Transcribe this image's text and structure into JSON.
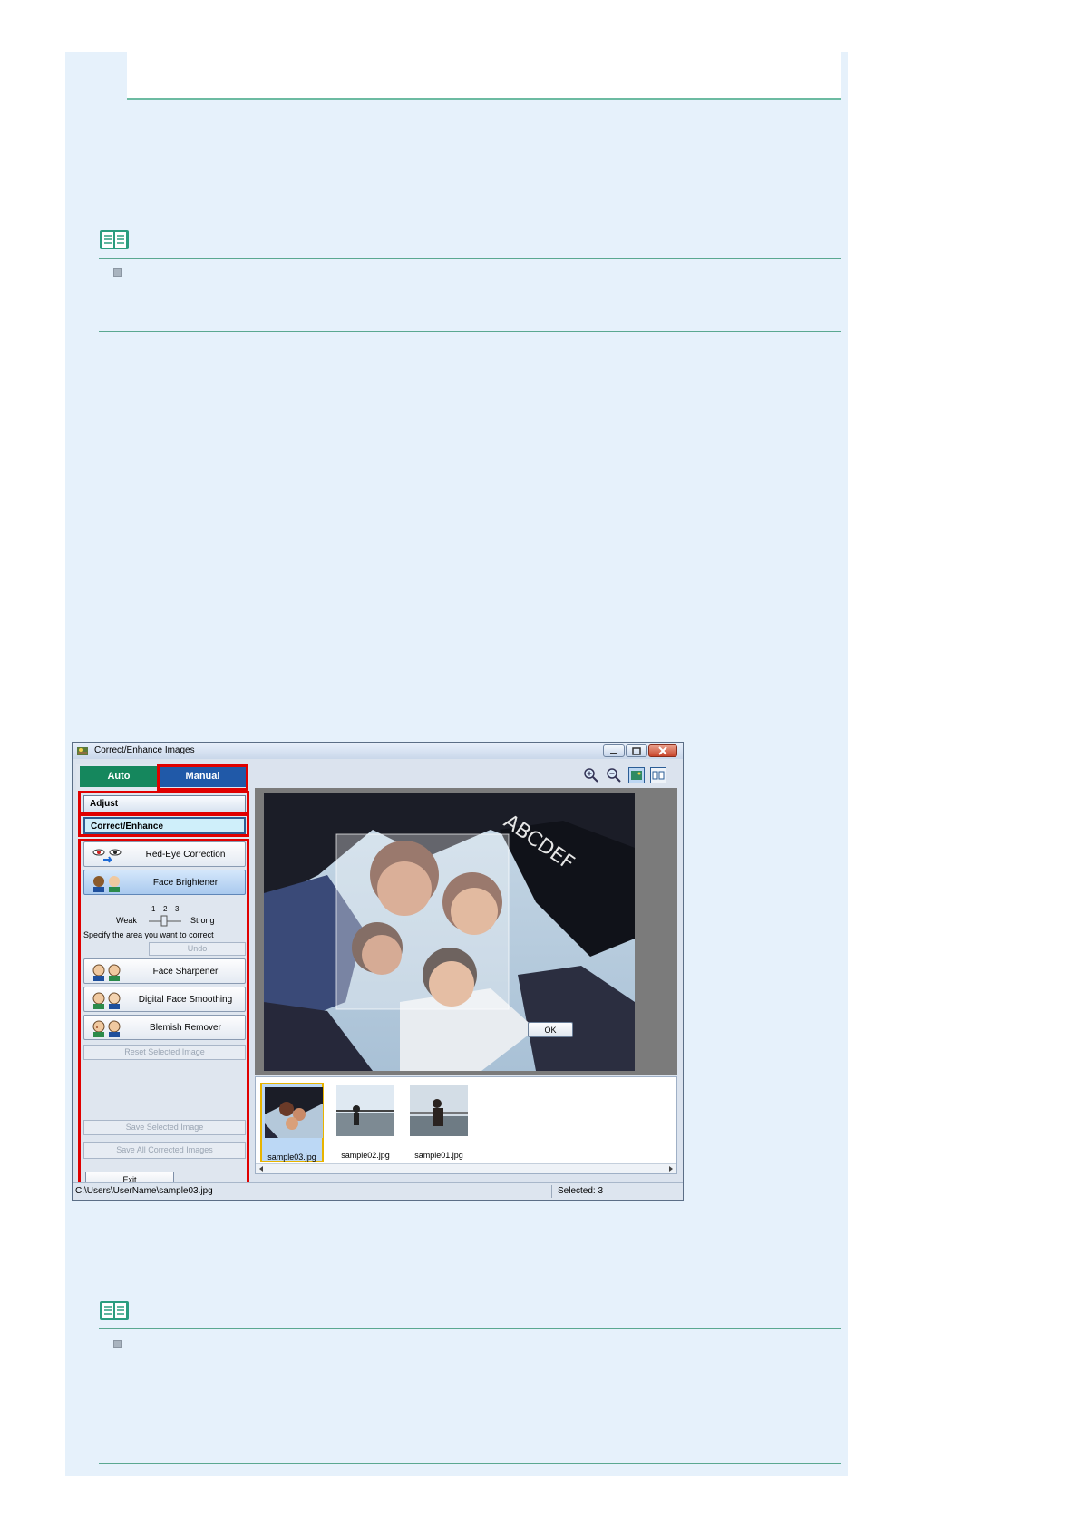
{
  "window": {
    "title": "Correct/Enhance Images",
    "tabs": {
      "auto": "Auto",
      "manual": "Manual"
    },
    "sections": {
      "adjust": "Adjust",
      "correct_enhance": "Correct/Enhance"
    },
    "tools": [
      {
        "label": "Red-Eye Correction",
        "icon": "red-eye-icon"
      },
      {
        "label": "Face Brightener",
        "icon": "face-brightener-icon"
      },
      {
        "label": "Face Sharpener",
        "icon": "face-sharpener-icon"
      },
      {
        "label": "Digital Face Smoothing",
        "icon": "face-smoothing-icon"
      },
      {
        "label": "Blemish Remover",
        "icon": "blemish-remover-icon"
      }
    ],
    "slider": {
      "weak": "Weak",
      "strong": "Strong",
      "ticks": [
        "1",
        "2",
        "3"
      ],
      "value": 2
    },
    "hint": "Specify the area you want to correct",
    "buttons": {
      "undo": "Undo",
      "reset": "Reset Selected Image",
      "save_selected": "Save Selected Image",
      "save_all": "Save All Corrected Images",
      "exit": "Exit",
      "ok": "OK"
    },
    "thumbnails": [
      {
        "name": "sample03.jpg",
        "selected": true
      },
      {
        "name": "sample02.jpg",
        "selected": false
      },
      {
        "name": "sample01.jpg",
        "selected": false
      }
    ],
    "status": {
      "path": "C:\\Users\\UserName\\sample03.jpg",
      "selected": "Selected: 3"
    }
  },
  "colors": {
    "highlight": "#e00000",
    "auto_tab": "#15875d",
    "manual_tab": "#2059a8",
    "page_bg": "#e6f1fb"
  }
}
